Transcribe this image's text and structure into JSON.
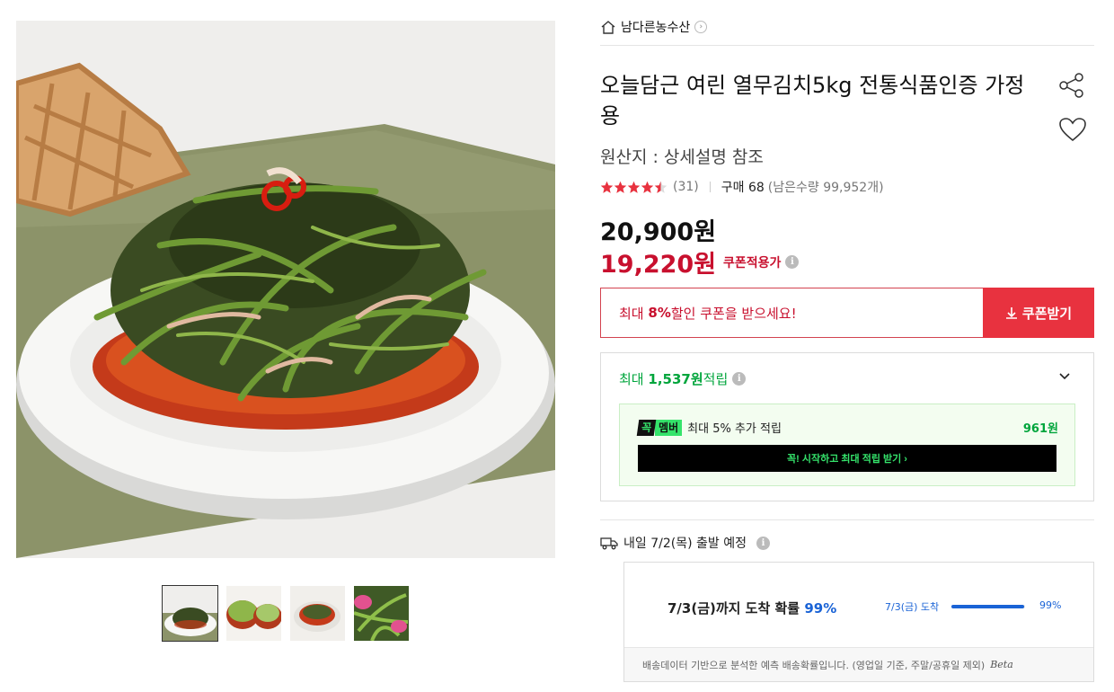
{
  "seller": {
    "name": "남다른농수산",
    "home_icon": "home-icon",
    "chevron_icon": "chevron-right-icon"
  },
  "product": {
    "title": "오늘담근 여린 열무김치5kg 전통식품인증 가정용",
    "origin": "원산지 : 상세설명 참조",
    "rating": 4.5,
    "review_count": "(31)",
    "purchase": "구매 68",
    "stock": "(남은수량 99,952개)",
    "price_original": "20,900원",
    "price_coupon": "19,220원",
    "coupon_price_label": "쿠폰적용가"
  },
  "coupon": {
    "prefix": "최대 ",
    "percent": "8%",
    "suffix": " 할인 쿠폰을 받으세요!",
    "button_label": "쿠폰받기"
  },
  "reward": {
    "prefix": "최대 ",
    "amount": "1,537원",
    "suffix": " 적립",
    "member_badge_k": "꼭",
    "member_badge_m": "멤버",
    "member_text": "최대 5% 추가 적립",
    "member_amount": "961원",
    "member_cta": "꼭! 시작하고 최대 적립 받기 ›"
  },
  "shipping": {
    "text": "내일 7/2(목) 출발 예정",
    "prob_main": "7/3(금)까지 도착 확률 ",
    "prob_pct": "99%",
    "bar_label": "7/3(금) 도착",
    "bar_value": 0.99,
    "bar_pct": "99%",
    "footer": "배송데이터 기반으로 분석한 예측 배송확률입니다. (영업일 기준, 주말/공휴일 제외)",
    "beta": "Beta"
  },
  "colors": {
    "accent_red": "#e8323f",
    "price_red": "#c8102e",
    "green": "#00a53c",
    "blue": "#1a63d6"
  }
}
